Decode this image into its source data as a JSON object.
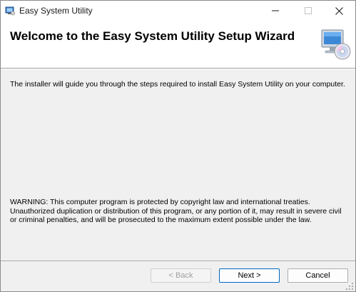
{
  "window": {
    "title": "Easy System Utility",
    "icons": {
      "app": "installer-app-icon",
      "banner": "computer-cd-icon"
    }
  },
  "banner": {
    "title": "Welcome to the Easy System Utility Setup Wizard"
  },
  "body": {
    "intro": "The installer will guide you through the steps required to install Easy System Utility on your computer.",
    "warning_lines": [
      "WARNING: This computer program is protected by copyright law and international treaties.",
      "Unauthorized duplication or distribution of this program, or any portion of it, may result in severe civil",
      "or criminal penalties, and will be prosecuted to the maximum extent possible under the law."
    ]
  },
  "buttons": {
    "back": "< Back",
    "next": "Next >",
    "cancel": "Cancel",
    "back_enabled": false
  },
  "colors": {
    "accent": "#0067c0",
    "window_bg": "#f0f0f0"
  }
}
